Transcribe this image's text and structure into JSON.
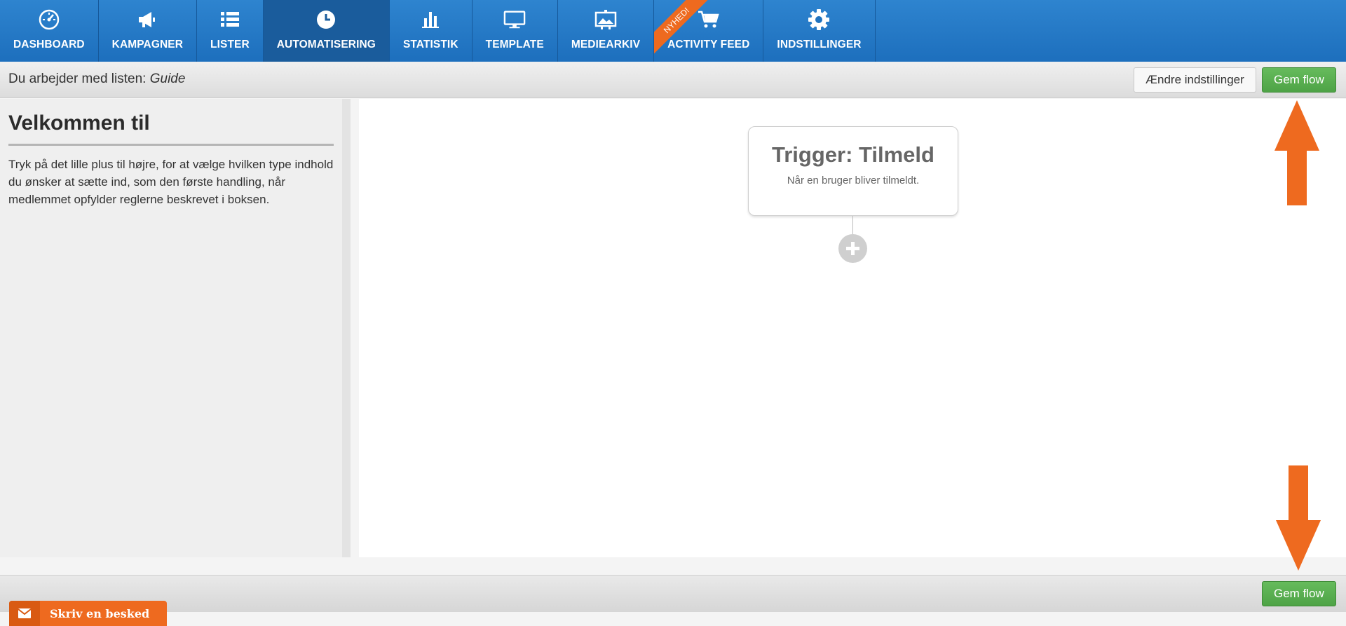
{
  "nav": {
    "items": [
      {
        "label": "DASHBOARD",
        "icon": "dashboard-gauge-icon"
      },
      {
        "label": "KAMPAGNER",
        "icon": "megaphone-icon"
      },
      {
        "label": "LISTER",
        "icon": "list-icon"
      },
      {
        "label": "AUTOMATISERING",
        "icon": "clock-icon",
        "active": true
      },
      {
        "label": "STATISTIK",
        "icon": "bar-chart-icon"
      },
      {
        "label": "TEMPLATE",
        "icon": "monitor-icon"
      },
      {
        "label": "MEDIEARKIV",
        "icon": "image-archive-icon"
      },
      {
        "label": "ACTIVITY FEED",
        "icon": "cart-icon",
        "badge": "NYHED!"
      },
      {
        "label": "INDSTILLINGER",
        "icon": "gear-icon"
      }
    ]
  },
  "subheader": {
    "working_prefix": "Du arbejder med listen:",
    "list_name": "Guide",
    "change_settings_label": "Ændre indstillinger",
    "save_flow_label": "Gem flow"
  },
  "sidebar": {
    "title": "Velkommen til",
    "body": "Tryk på det lille plus til højre, for at vælge hvilken type indhold du ønsker at sætte ind, som den første handling, når medlemmet opfylder reglerne beskrevet i boksen."
  },
  "flow": {
    "trigger_title": "Trigger: Tilmeld",
    "trigger_desc": "Når en bruger bliver tilmeldt."
  },
  "footer": {
    "save_flow_label": "Gem flow"
  },
  "chat": {
    "label": "Skriv en besked",
    "icon": "envelope-icon"
  },
  "colors": {
    "nav_blue": "#2e84cf",
    "accent_orange": "#ee6a1f",
    "button_green": "#5cb85c"
  }
}
